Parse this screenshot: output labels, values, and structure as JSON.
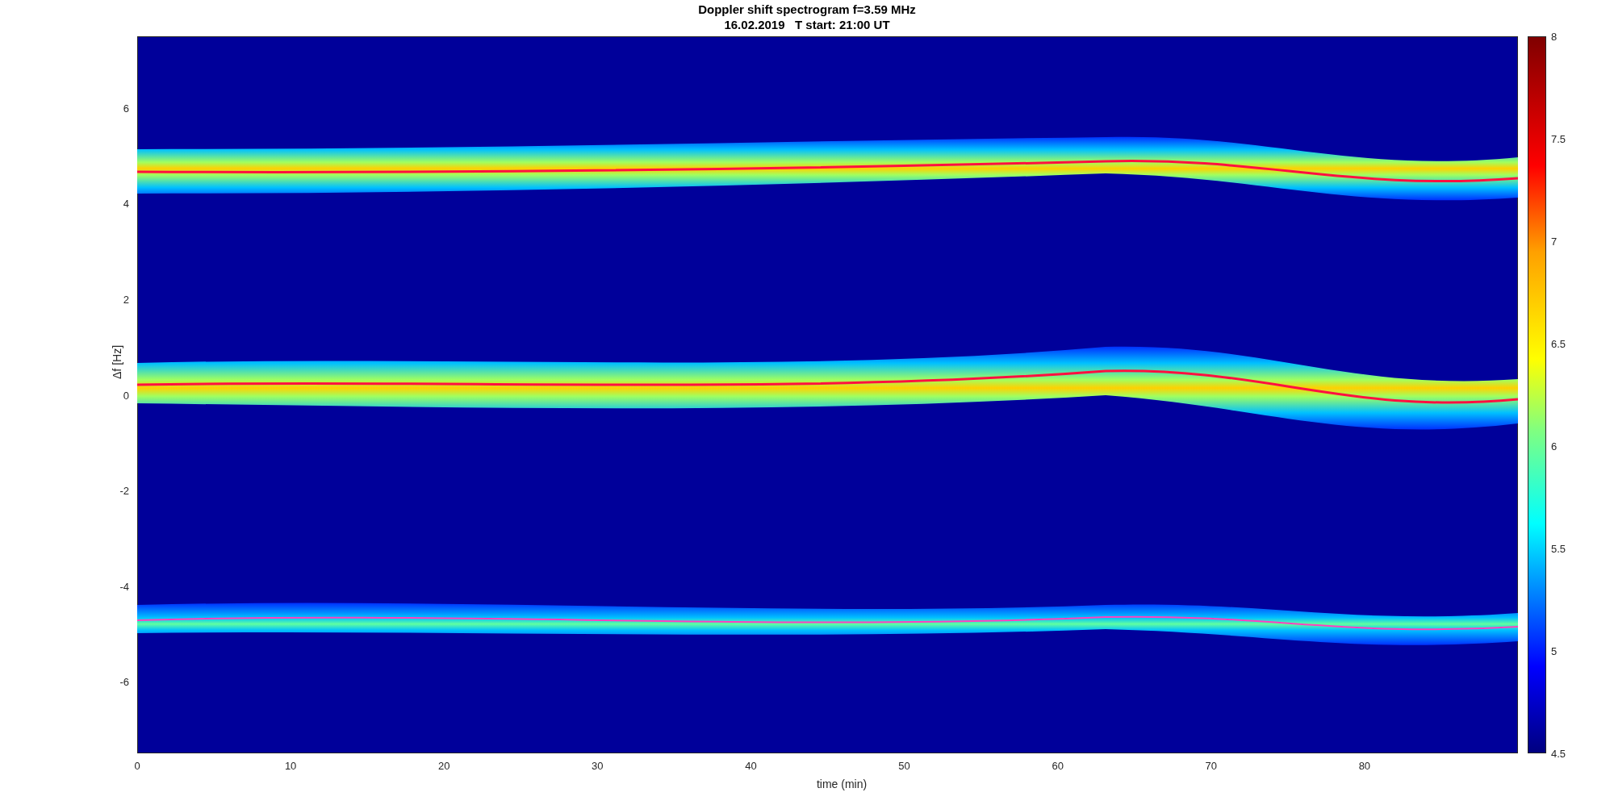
{
  "title": [
    "Doppler shift spectrogram f=3.59 MHz",
    "16.02.2019   T start: 21:00 UT"
  ],
  "xlabel": "time (min)",
  "ylabel": "Δf [Hz]",
  "xticks": [
    "0",
    "10",
    "20",
    "30",
    "40",
    "50",
    "60",
    "70",
    "80"
  ],
  "yticks": [
    "6",
    "4",
    "2",
    "0",
    "-2",
    "-4",
    "-6"
  ],
  "colorbar_ticks": [
    "8",
    "7.5",
    "7",
    "6.5",
    "6",
    "5.5",
    "5",
    "4.5"
  ]
}
